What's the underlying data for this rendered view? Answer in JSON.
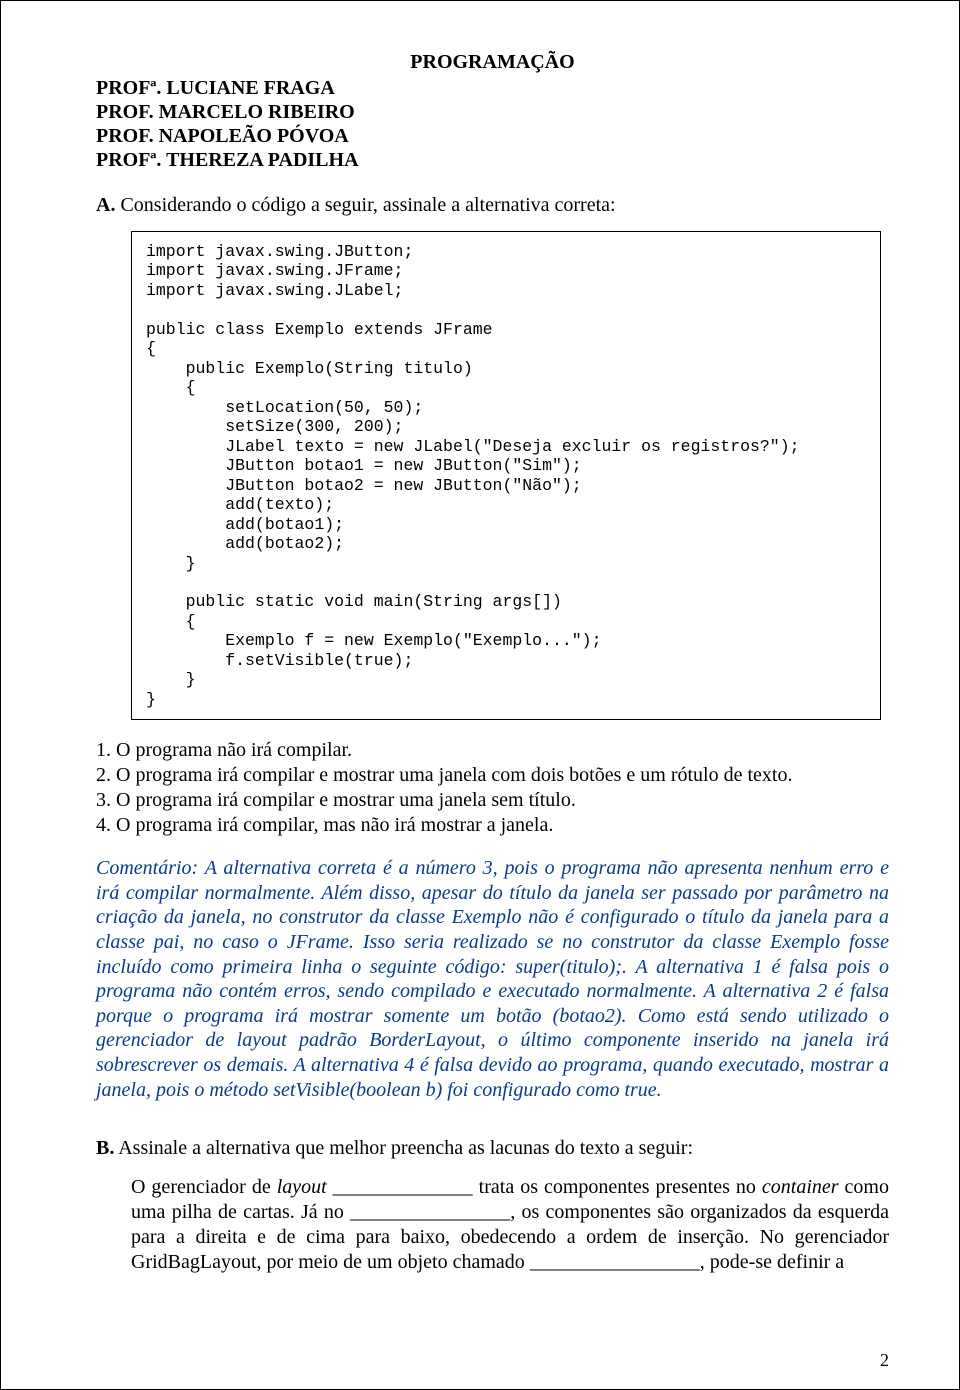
{
  "header": {
    "title": "PROGRAMAÇÃO",
    "profs": [
      "PROFª. LUCIANE FRAGA",
      "PROF. MARCELO RIBEIRO",
      "PROF. NAPOLEÃO PÓVOA",
      "PROFª. THEREZA PADILHA"
    ]
  },
  "sectionA": {
    "label": "A.",
    "intro": " Considerando o código a seguir, assinale a alternativa correta:",
    "code": "import javax.swing.JButton;\nimport javax.swing.JFrame;\nimport javax.swing.JLabel;\n\npublic class Exemplo extends JFrame\n{\n    public Exemplo(String titulo)\n    {\n        setLocation(50, 50);\n        setSize(300, 200);\n        JLabel texto = new JLabel(\"Deseja excluir os registros?\");\n        JButton botao1 = new JButton(\"Sim\");\n        JButton botao2 = new JButton(\"Não\");\n        add(texto);\n        add(botao1);\n        add(botao2);\n    }\n\n    public static void main(String args[])\n    {\n        Exemplo f = new Exemplo(\"Exemplo...\");\n        f.setVisible(true);\n    }\n}",
    "options": [
      "1. O programa não irá compilar.",
      "2. O programa irá compilar e mostrar uma janela com dois botões e um rótulo de texto.",
      "3. O programa irá compilar e mostrar uma janela sem título.",
      "4. O programa irá compilar, mas não irá mostrar a janela."
    ],
    "comment": "Comentário: A alternativa correta é a número 3, pois o programa não apresenta nenhum erro e irá compilar normalmente. Além disso, apesar do título da janela ser passado por parâmetro na criação da janela, no construtor da classe Exemplo não é configurado o título da janela para a classe pai, no caso o JFrame. Isso seria realizado se no construtor da classe Exemplo fosse incluído como primeira linha o seguinte código: super(titulo);. A alternativa 1 é falsa pois o programa não contém erros, sendo compilado e executado normalmente. A alternativa 2 é falsa porque o programa irá mostrar somente um botão (botao2). Como está sendo utilizado o gerenciador de layout padrão BorderLayout, o último componente inserido na janela irá sobrescrever os demais. A alternativa 4 é falsa devido ao programa, quando executado, mostrar a janela, pois o método setVisible(boolean b) foi configurado como true."
  },
  "sectionB": {
    "label": "B.",
    "intro": " Assinale a alternativa que melhor preencha as lacunas do texto a seguir:",
    "body_part1": "O gerenciador de ",
    "body_italic1": "layout",
    "body_part2": " ______________ trata os componentes presentes no ",
    "body_italic2": "container",
    "body_part3": " como uma pilha de cartas. Já no ________________, os componentes são organizados da esquerda para a direita e de cima para baixo, obedecendo a ordem de inserção. No gerenciador GridBagLayout, por meio de um objeto chamado _________________, pode-se definir a"
  },
  "pageNumber": "2"
}
